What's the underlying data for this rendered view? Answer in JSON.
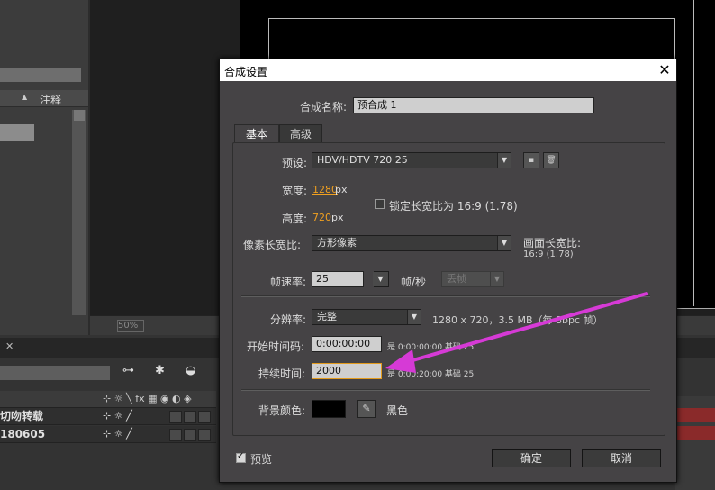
{
  "background": {
    "left_panel_header": "注释",
    "viewer_zoom": "50%",
    "timeline_rows": [
      "切吻转载",
      "180605"
    ]
  },
  "dialog": {
    "title": "合成设置",
    "name_label": "合成名称:",
    "name_value": "预合成 1",
    "tabs": [
      "基本",
      "高级"
    ],
    "preset_label": "预设:",
    "preset_value": "HDV/HDTV 720 25",
    "width_label": "宽度:",
    "width_value": "1280",
    "height_label": "高度:",
    "height_value": "720",
    "px": "px",
    "lock_ratio_label": "锁定长宽比为 16:9 (1.78)",
    "pixel_ratio_label": "像素长宽比:",
    "pixel_ratio_value": "方形像素",
    "frame_ratio_label": "画面长宽比:",
    "frame_ratio_value": "16:9 (1.78)",
    "fps_label": "帧速率:",
    "fps_value": "25",
    "fps_unit": "帧/秒",
    "frame_drop": "丢帧",
    "resolution_label": "分辨率:",
    "resolution_value": "完整",
    "resolution_info": "1280 x 720，3.5 MB（每 8bpc 帧）",
    "start_label": "开始时间码:",
    "start_value": "0:00:00:00",
    "start_info": "是 0:00:00:00  基础 25",
    "duration_label": "持续时间:",
    "duration_value": "2000",
    "duration_info": "是 0:00:20:00  基础 25",
    "bg_color_label": "背景颜色:",
    "bg_color_name": "黑色",
    "bg_color_hex": "#000000",
    "preview_label": "预览",
    "ok_label": "确定",
    "cancel_label": "取消"
  },
  "colors": {
    "annotation_arrow": "#d63ad6",
    "value_orange": "#f0a020"
  }
}
